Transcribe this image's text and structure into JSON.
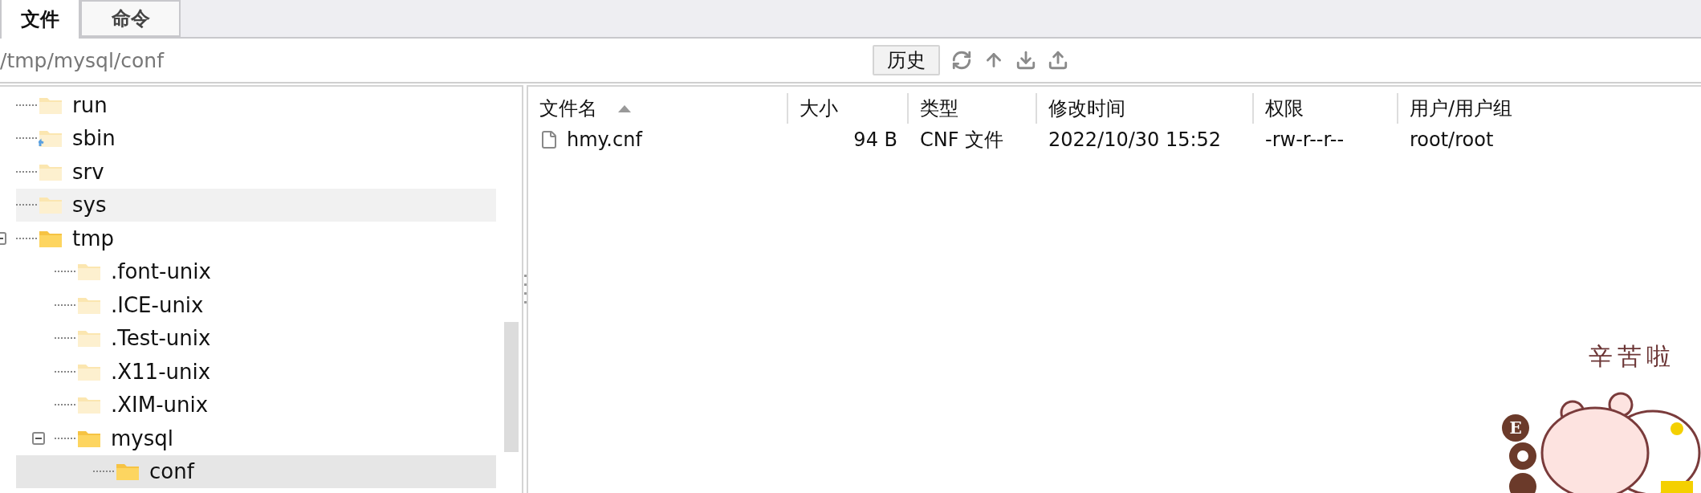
{
  "tabs": [
    {
      "label": "文件",
      "selected": true
    },
    {
      "label": "命令",
      "selected": false
    }
  ],
  "path_bar": {
    "path": "/tmp/mysql/conf",
    "history_button": "历史"
  },
  "tree": [
    {
      "name": "run",
      "expanded": false,
      "selected": false,
      "hovered": false,
      "symlink": false
    },
    {
      "name": "sbin",
      "expanded": false,
      "selected": false,
      "hovered": false,
      "symlink": true
    },
    {
      "name": "srv",
      "expanded": false,
      "selected": false,
      "hovered": false,
      "symlink": false
    },
    {
      "name": "sys",
      "expanded": false,
      "selected": false,
      "hovered": true,
      "symlink": false
    },
    {
      "name": "tmp",
      "expanded": true,
      "selected": false,
      "hovered": false,
      "symlink": false,
      "children": [
        {
          "name": ".font-unix",
          "expanded": false,
          "selected": false,
          "hovered": false,
          "symlink": false
        },
        {
          "name": ".ICE-unix",
          "expanded": false,
          "selected": false,
          "hovered": false,
          "symlink": false
        },
        {
          "name": ".Test-unix",
          "expanded": false,
          "selected": false,
          "hovered": false,
          "symlink": false
        },
        {
          "name": ".X11-unix",
          "expanded": false,
          "selected": false,
          "hovered": false,
          "symlink": false
        },
        {
          "name": ".XIM-unix",
          "expanded": false,
          "selected": false,
          "hovered": false,
          "symlink": false
        },
        {
          "name": "mysql",
          "expanded": true,
          "selected": false,
          "hovered": false,
          "symlink": false,
          "children": [
            {
              "name": "conf",
              "expanded": false,
              "selected": true,
              "hovered": false,
              "symlink": false
            }
          ]
        }
      ]
    }
  ],
  "table": {
    "columns": [
      {
        "label": "文件名",
        "sorted_ascending": true
      },
      {
        "label": "大小",
        "sorted_ascending": false
      },
      {
        "label": "类型",
        "sorted_ascending": false
      },
      {
        "label": "修改时间",
        "sorted_ascending": false
      },
      {
        "label": "权限",
        "sorted_ascending": false
      },
      {
        "label": "用户/用户组",
        "sorted_ascending": false
      }
    ],
    "rows": [
      {
        "cells": [
          "hmy.cnf",
          "94 B",
          "CNF 文件",
          "2022/10/30 15:52",
          "-rw-r--r--",
          "root/root"
        ]
      }
    ]
  },
  "sticker": {
    "caption": "辛苦啦",
    "badge_letter": "E"
  }
}
